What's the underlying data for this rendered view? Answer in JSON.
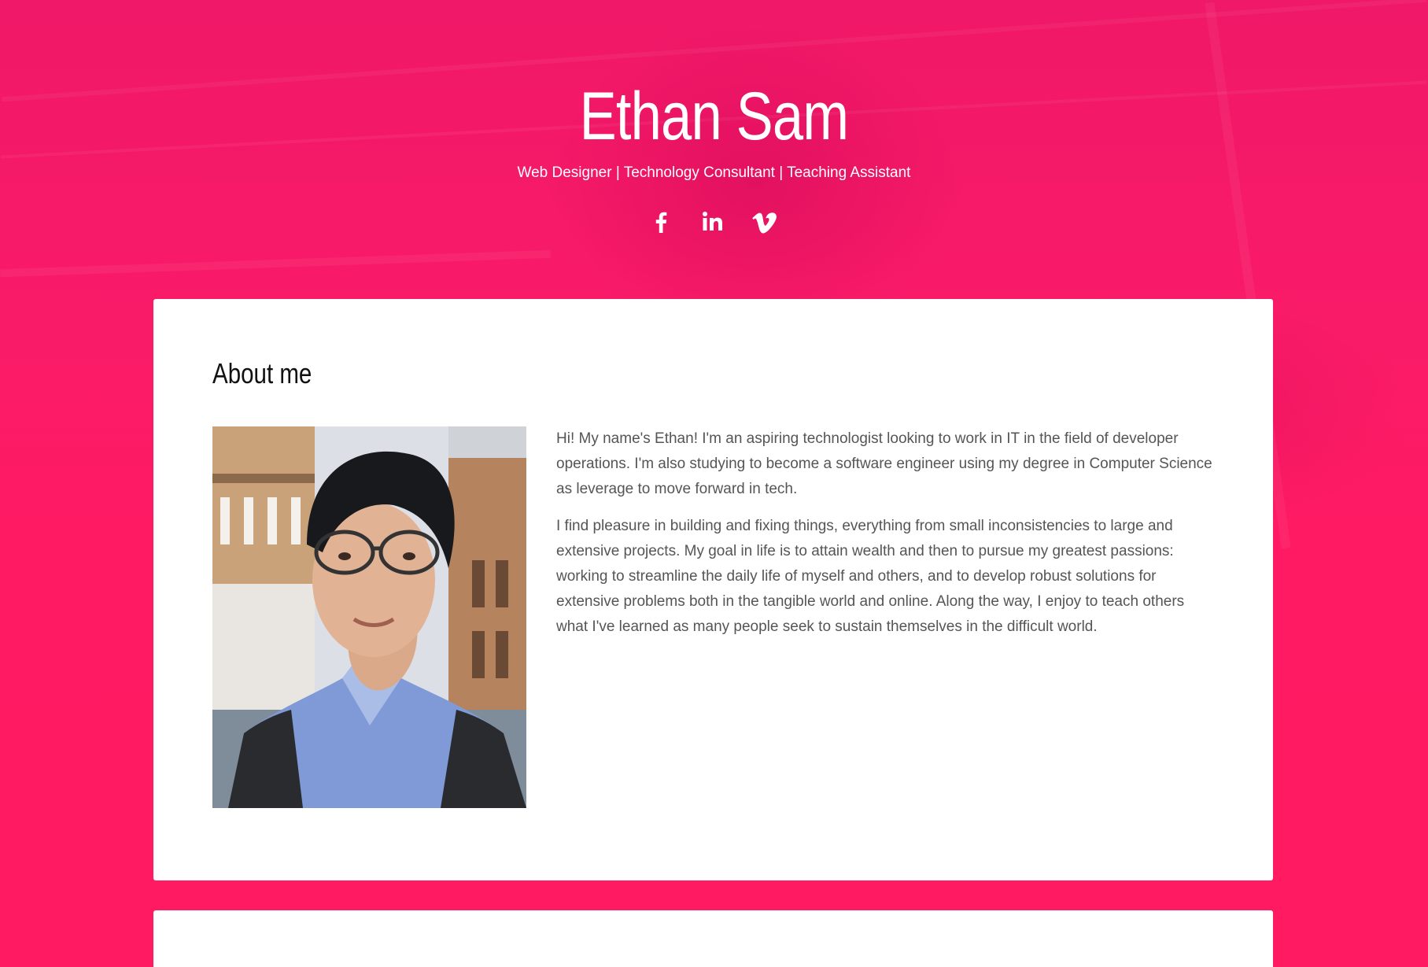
{
  "hero": {
    "title": "Ethan Sam",
    "subtitle": "Web Designer | Technology Consultant | Teaching Assistant",
    "social": [
      {
        "icon": "facebook-icon"
      },
      {
        "icon": "linkedin-icon"
      },
      {
        "icon": "vimeo-icon"
      }
    ]
  },
  "about": {
    "heading": "About me",
    "paragraphs": [
      "Hi! My name's Ethan! I'm an aspiring technologist looking to work in IT in the field of developer operations. I'm also studying to become a software engineer using my degree in Computer Science as leverage to move forward in tech.",
      "I find pleasure in building and fixing things, everything from small inconsistencies to large and extensive projects. My goal in life is to attain wealth and then to pursue my greatest passions: working to streamline the daily life of myself and others, and to develop robust solutions for extensive problems both in the tangible world and online. Along the way, I enjoy to teach others what I've learned as many people seek to sustain themselves in the difficult world."
    ]
  },
  "colors": {
    "accent": "#ff1a62",
    "card": "#ffffff",
    "heading": "#111111",
    "body_text": "#555555"
  }
}
